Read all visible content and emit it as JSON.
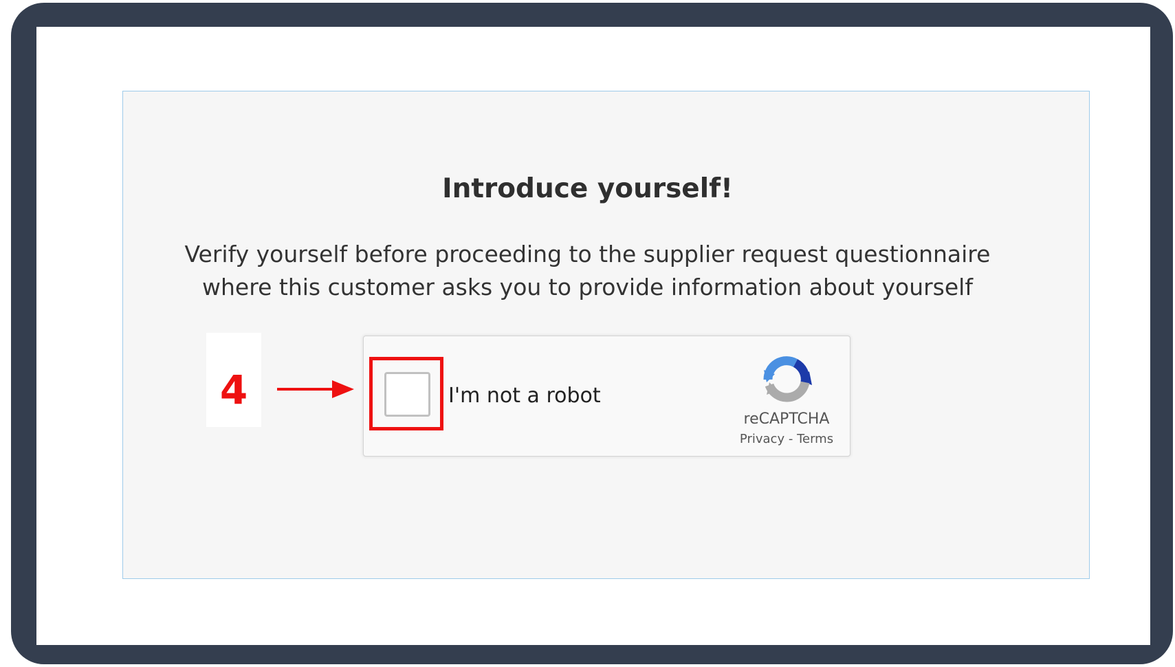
{
  "page": {
    "title": "Introduce yourself!",
    "subtitle_lines": [
      "Verify yourself before proceeding to the supplier request questionnaire",
      "where this customer asks you to provide information about yourself"
    ]
  },
  "annotation": {
    "step_number": "4",
    "color": "#ee1111"
  },
  "recaptcha": {
    "checkbox_label": "I'm not a robot",
    "checked": false,
    "brand": "reCAPTCHA",
    "privacy_label": "Privacy",
    "separator": "-",
    "terms_label": "Terms",
    "icon": "recaptcha-logo-icon"
  },
  "colors": {
    "frame": "#343e4f",
    "card_background": "#f6f6f6",
    "card_border": "#9ecbea"
  }
}
